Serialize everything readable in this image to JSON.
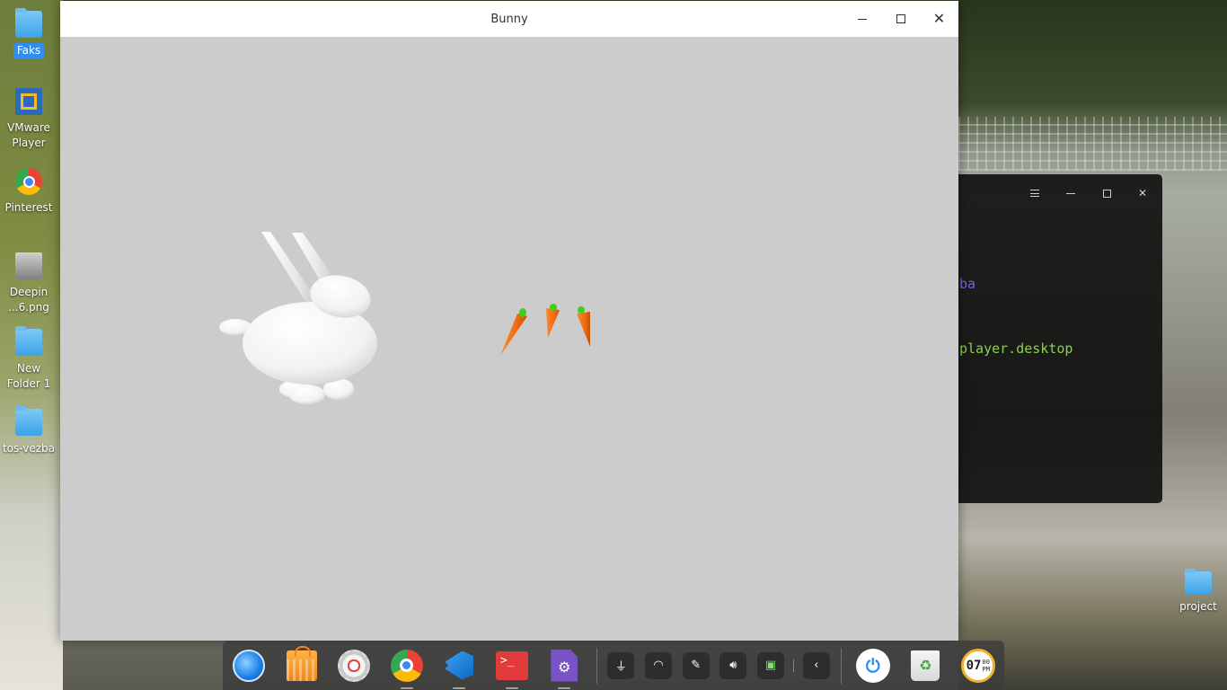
{
  "desktop": {
    "icons_left": [
      {
        "label": "Faks",
        "type": "folder",
        "selected": true
      },
      {
        "label": "VMware Player",
        "type": "vmware"
      },
      {
        "label": "Pinterest",
        "type": "chrome"
      },
      {
        "label": "Deepin ...6.png",
        "type": "image"
      },
      {
        "label": "New Folder 1",
        "type": "folder"
      },
      {
        "label": "tos-vezba",
        "type": "folder"
      }
    ],
    "icon_right": {
      "label": "project",
      "type": "folder"
    }
  },
  "app_window": {
    "title": "Bunny",
    "background_color": "#cccccc",
    "scene": {
      "bunny_color": "#ffffff",
      "carrot_color": "#f26b12",
      "carrot_top_color": "#3ccf1f",
      "carrot_count": 3
    }
  },
  "terminal_window": {
    "line1": "ba",
    "line2": "player.desktop",
    "line1_color": "#6a6adf",
    "line2_color": "#8ad14a"
  },
  "dock": {
    "apps": [
      {
        "name": "launcher-icon"
      },
      {
        "name": "app-store-icon"
      },
      {
        "name": "control-center-icon"
      },
      {
        "name": "chrome-icon"
      },
      {
        "name": "vscode-icon"
      },
      {
        "name": "terminal-icon"
      },
      {
        "name": "settings-document-icon"
      }
    ],
    "terminal_prompt": ">_",
    "clock": {
      "hour": "07",
      "minute": "00",
      "ampm": "PM"
    }
  }
}
